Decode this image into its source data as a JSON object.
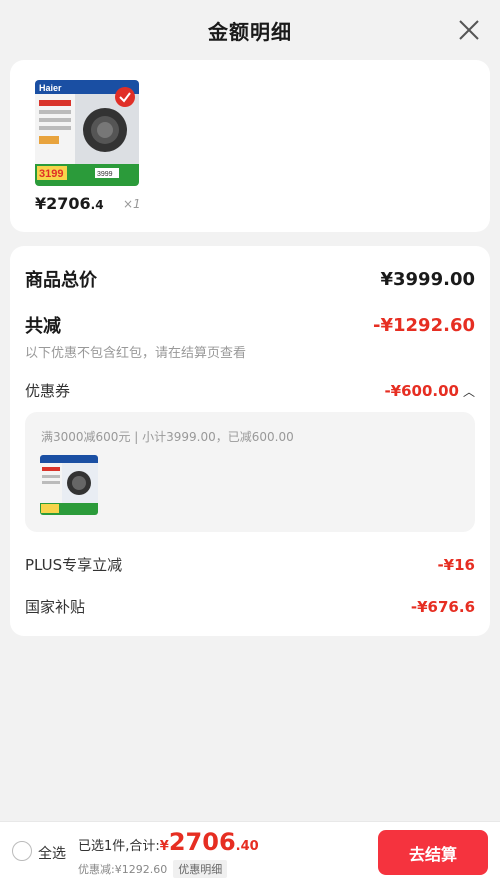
{
  "header": {
    "title": "金额明细"
  },
  "product": {
    "price_main": "¥2706",
    "price_decimal": ".4",
    "qty": "×1",
    "brand": "Haier",
    "promo_price": "3199",
    "image_price": "3999"
  },
  "summary": {
    "total_label": "商品总价",
    "total_value": "¥3999.00",
    "reduce_label": "共减",
    "reduce_value": "-¥1292.60",
    "note": "以下优惠不包含红包，请在结算页查看",
    "coupon_label": "优惠券",
    "coupon_value": "-¥600.00",
    "coupon_detail": "满3000减600元 | 小计3999.00，已减600.00",
    "plus_label": "PLUS专享立减",
    "plus_value": "-¥16",
    "subsidy_label": "国家补贴",
    "subsidy_value": "-¥676.6"
  },
  "footer": {
    "select_all": "全选",
    "selected_label": "已选1件,合计:",
    "total_yen": "¥",
    "total_int": "2706",
    "total_dec": ".40",
    "discount": "优惠减:¥1292.60",
    "detail_tag": "优惠明细",
    "checkout": "去结算"
  },
  "colors": {
    "accent": "#e62e22",
    "button": "#f5333e"
  }
}
